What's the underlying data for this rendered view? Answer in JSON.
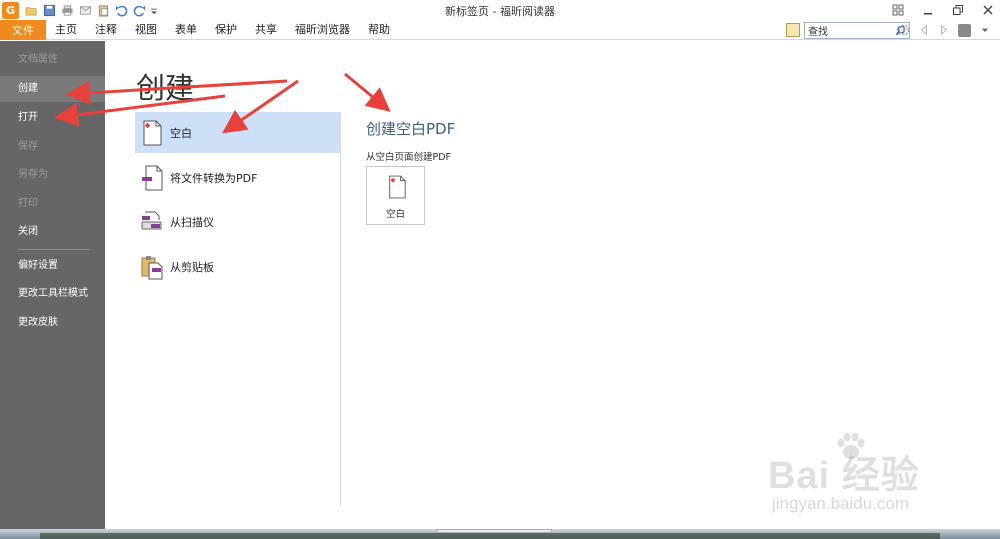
{
  "window": {
    "title": "新标签页 - 福昕阅读器"
  },
  "app": {
    "logo_letter": "G"
  },
  "menubar": {
    "file_tab": "文件",
    "tabs": [
      "主页",
      "注释",
      "视图",
      "表单",
      "保护",
      "共享",
      "福昕浏览器",
      "帮助"
    ],
    "search_value": "查找"
  },
  "sidebar": {
    "items": [
      {
        "label": "文档属性",
        "state": "disabled"
      },
      {
        "label": "创建",
        "state": "active"
      },
      {
        "label": "打开",
        "state": "normal"
      },
      {
        "label": "保存",
        "state": "disabled"
      },
      {
        "label": "另存为",
        "state": "disabled"
      },
      {
        "label": "打印",
        "state": "disabled"
      },
      {
        "label": "关闭",
        "state": "normal"
      },
      {
        "label": "偏好设置",
        "state": "normal"
      },
      {
        "label": "更改工具栏模式",
        "state": "normal"
      },
      {
        "label": "更改皮肤",
        "state": "normal"
      }
    ]
  },
  "main": {
    "title": "创建",
    "options": [
      {
        "label": "空白",
        "icon": "blank-page-icon",
        "selected": true
      },
      {
        "label": "将文件转换为PDF",
        "icon": "convert-file-icon",
        "selected": false
      },
      {
        "label": "从扫描仪",
        "icon": "scanner-icon",
        "selected": false
      },
      {
        "label": "从剪贴板",
        "icon": "clipboard-icon",
        "selected": false
      }
    ],
    "detail": {
      "title": "创建空白PDF",
      "subtitle": "从空白页面创建PDF",
      "tile_label": "空白"
    }
  },
  "watermark": {
    "brand": "Bai  经验",
    "url": "jingyan.baidu.com"
  },
  "colors": {
    "accent": "#f08a1c",
    "sidebar": "#666666",
    "selected": "#cde0f7",
    "arrow": "#e8403a",
    "detail_title": "#3b5f8c"
  }
}
